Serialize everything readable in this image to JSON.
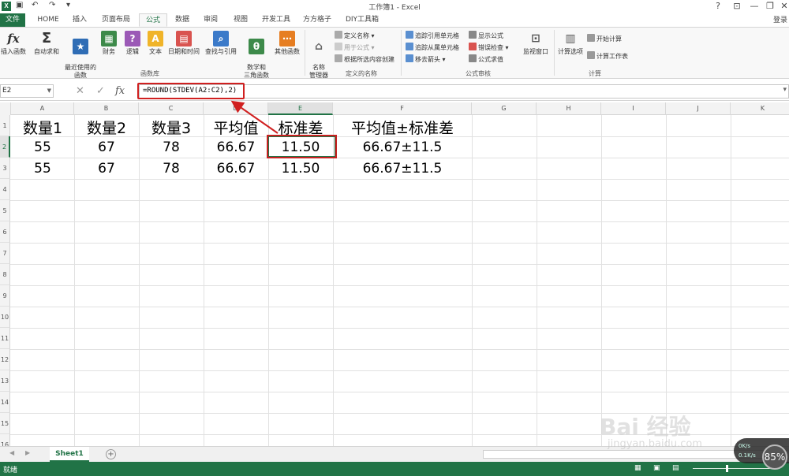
{
  "window": {
    "title": "工作簿1 - Excel",
    "help": "?",
    "ribbon_opt": "⊡",
    "minimize": "—",
    "restore": "❐",
    "close": "✕"
  },
  "quick_access": {
    "app_icon": "X",
    "save": "💾",
    "undo": "↶",
    "redo": "↷",
    "customize": "▾"
  },
  "tabs": {
    "file": "文件",
    "items": [
      "HOME",
      "插入",
      "页面布局",
      "公式",
      "数据",
      "审阅",
      "视图",
      "开发工具",
      "方方格子",
      "DIY工具箱"
    ],
    "active": "公式",
    "login": "登录"
  },
  "ribbon": {
    "function_library": {
      "insert_function": "插入函数",
      "autosum": "自动求和",
      "recent": "最近使用的\n函数",
      "financial": "财务",
      "logical": "逻辑",
      "text": "文本",
      "datetime": "日期和时间",
      "lookup": "查找与引用",
      "math": "数学和\n三角函数",
      "more": "其他函数",
      "group_label": "函数库"
    },
    "defined_names": {
      "name_manager": "名称\n管理器",
      "define_name": "定义名称",
      "use_in_formula": "用于公式",
      "create_from_selection": "根据所选内容创建",
      "group_label": "定义的名称"
    },
    "formula_auditing": {
      "trace_precedents": "追踪引用单元格",
      "trace_dependents": "追踪从属单元格",
      "remove_arrows": "移去箭头",
      "show_formulas": "显示公式",
      "error_checking": "错误检查",
      "evaluate_formula": "公式求值",
      "group_label": "公式审核"
    },
    "watch_window": "监视窗口",
    "calculation": {
      "calc_options": "计算选项",
      "calc_now": "开始计算",
      "calc_sheet": "计算工作表",
      "group_label": "计算"
    }
  },
  "formula_bar": {
    "name_box": "E2",
    "cancel": "✕",
    "enter": "✓",
    "fx": "fx",
    "formula": "=ROUND(STDEV(A2:C2),2)"
  },
  "grid": {
    "columns": [
      "A",
      "B",
      "C",
      "D",
      "E",
      "F",
      "G",
      "H",
      "I",
      "J",
      "K"
    ],
    "selected_column": "E",
    "rows": [
      "1",
      "2",
      "3",
      "4",
      "5",
      "6",
      "7",
      "8",
      "9",
      "10",
      "11",
      "12",
      "13",
      "14",
      "15",
      "16"
    ],
    "selected_row": "2",
    "headers": [
      "数量1",
      "数量2",
      "数量3",
      "平均值",
      "标准差",
      "平均值±标准差"
    ],
    "data": [
      [
        "55",
        "67",
        "78",
        "66.67",
        "11.50",
        "66.67±11.5"
      ],
      [
        "55",
        "67",
        "78",
        "66.67",
        "11.50",
        "66.67±11.5"
      ]
    ]
  },
  "sheets": {
    "tabs": [
      "Sheet1"
    ],
    "add": "+"
  },
  "status": {
    "text": "就绪"
  },
  "overlay": {
    "upload": "0K/s",
    "download": "0.1K/s",
    "zoom": "85%",
    "watermark": "Bai 经验",
    "watermark_url": "jingyan.baidu.com"
  },
  "colors": {
    "excel_green": "#217346",
    "highlight_red": "#d02020"
  }
}
